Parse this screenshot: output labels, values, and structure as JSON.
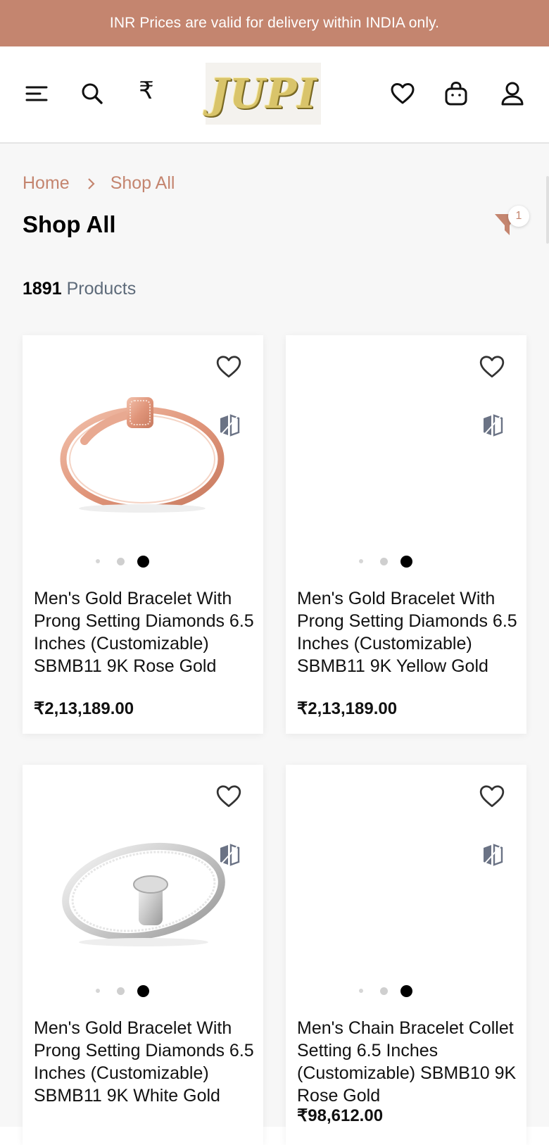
{
  "banner": {
    "text": "INR Prices are valid for delivery within INDIA only."
  },
  "header": {
    "menu_icon": "hamburger-menu-icon",
    "search_icon": "search-icon",
    "currency_icon": "rupee-currency-icon",
    "currency_symbol": "₹",
    "logo_text": "JUPI",
    "wishlist_icon": "heart-icon",
    "cart_icon": "shopping-bag-icon",
    "account_icon": "user-icon"
  },
  "breadcrumb": {
    "home": "Home",
    "current": "Shop All"
  },
  "page": {
    "title": "Shop All",
    "filter_badge": "1",
    "product_count": "1891",
    "product_count_label": "Products"
  },
  "colors": {
    "accent": "#c4856f",
    "banner_bg": "#c4856f",
    "text_dark": "#111111",
    "muted": "#5e6b7a"
  },
  "products": [
    {
      "name": "Men's Gold Bracelet With Prong Setting Diamonds 6.5 Inches (Customizable) SBMB11 9K Rose Gold",
      "price": "₹2,13,189.00",
      "image": "rose-gold-nail-bracelet"
    },
    {
      "name": "Men's Gold Bracelet With Prong Setting Diamonds 6.5 Inches (Customizable) SBMB11 9K Yellow Gold",
      "price": "₹2,13,189.00",
      "image": ""
    },
    {
      "name": "Men's Gold Bracelet With Prong Setting Diamonds 6.5 Inches (Customizable) SBMB11 9K White Gold",
      "price": "",
      "image": "white-gold-nail-bracelet"
    },
    {
      "name": "Men's Chain Bracelet Collet Setting 6.5 Inches (Customizable) SBMB10 9K Rose Gold",
      "price": "₹98,612.00",
      "image": ""
    }
  ]
}
